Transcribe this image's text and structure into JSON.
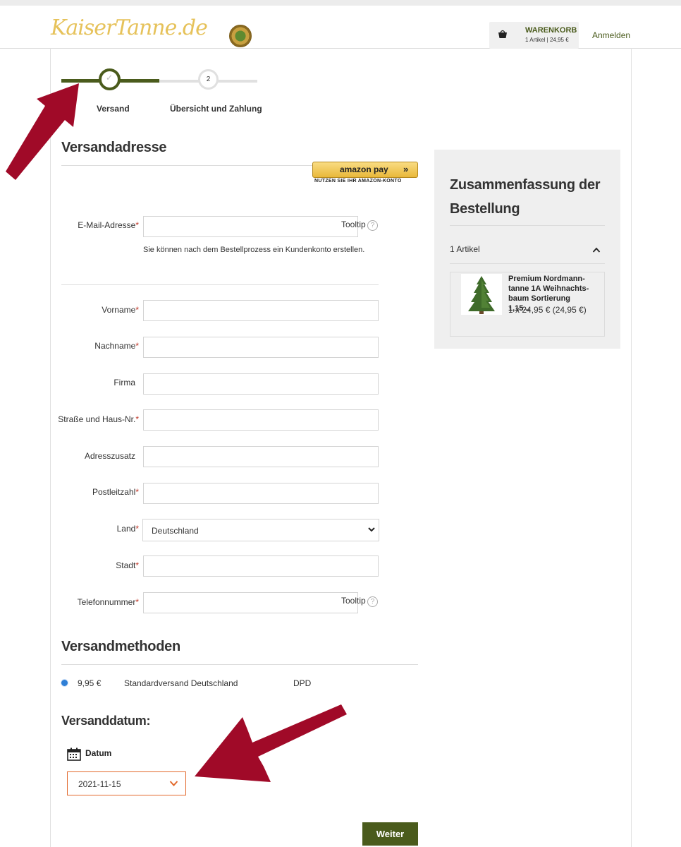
{
  "header": {
    "logo_text": "KaiserTanne.de",
    "cart_title": "WARENKORB",
    "cart_summary": "1 Artikel  |  24,95 €",
    "login_label": "Anmelden"
  },
  "stepper": {
    "steps": [
      {
        "label": "Versand",
        "state": "active"
      },
      {
        "label": "Übersicht und Zahlung",
        "number": "2",
        "state": "pending"
      }
    ]
  },
  "address": {
    "heading": "Versandadresse",
    "amazon_button_text": "amazon pay",
    "amazon_sub_text": "NUTZEN SIE IHR AMAZON-KONTO",
    "email_label": "E-Mail-Adresse",
    "email_tooltip": "Tooltip",
    "account_note": "Sie können nach dem Bestellprozess ein Kundenkonto erstellen.",
    "fields": [
      {
        "label": "Vorname",
        "required": "*"
      },
      {
        "label": "Nachname",
        "required": "*"
      },
      {
        "label": "Firma",
        "required": ""
      },
      {
        "label": "Straße und Haus-Nr.",
        "required": "*"
      },
      {
        "label": "Adresszusatz",
        "required": ""
      },
      {
        "label": "Postleitzahl",
        "required": "*"
      }
    ],
    "country_label": "Land",
    "country_value": "Deutschland",
    "city_label": "Stadt",
    "phone_label": "Telefonnummer",
    "phone_tooltip": "Tooltip",
    "required_mark": "*"
  },
  "shipping": {
    "heading": "Versandmethoden",
    "method": {
      "price": "9,95 €",
      "name": "Standardversand Deutschland",
      "carrier": "DPD",
      "selected": true
    }
  },
  "date": {
    "heading": "Versanddatum:",
    "label": "Datum",
    "value": "2021-11-15"
  },
  "actions": {
    "continue_label": "Weiter"
  },
  "summary": {
    "title": "Zusammenfassung der Bestellung",
    "item_count": "1 Artikel",
    "item": {
      "name": "Premium Nordmann-tanne 1A Weihnachts-baum Sortierung 1,15...",
      "price_line": "1 x 24,95 € (24,95 €)"
    }
  },
  "colors": {
    "brand_green": "#4a5b1c",
    "annotation_arrow": "#a00a28",
    "date_border": "#e2692c"
  }
}
